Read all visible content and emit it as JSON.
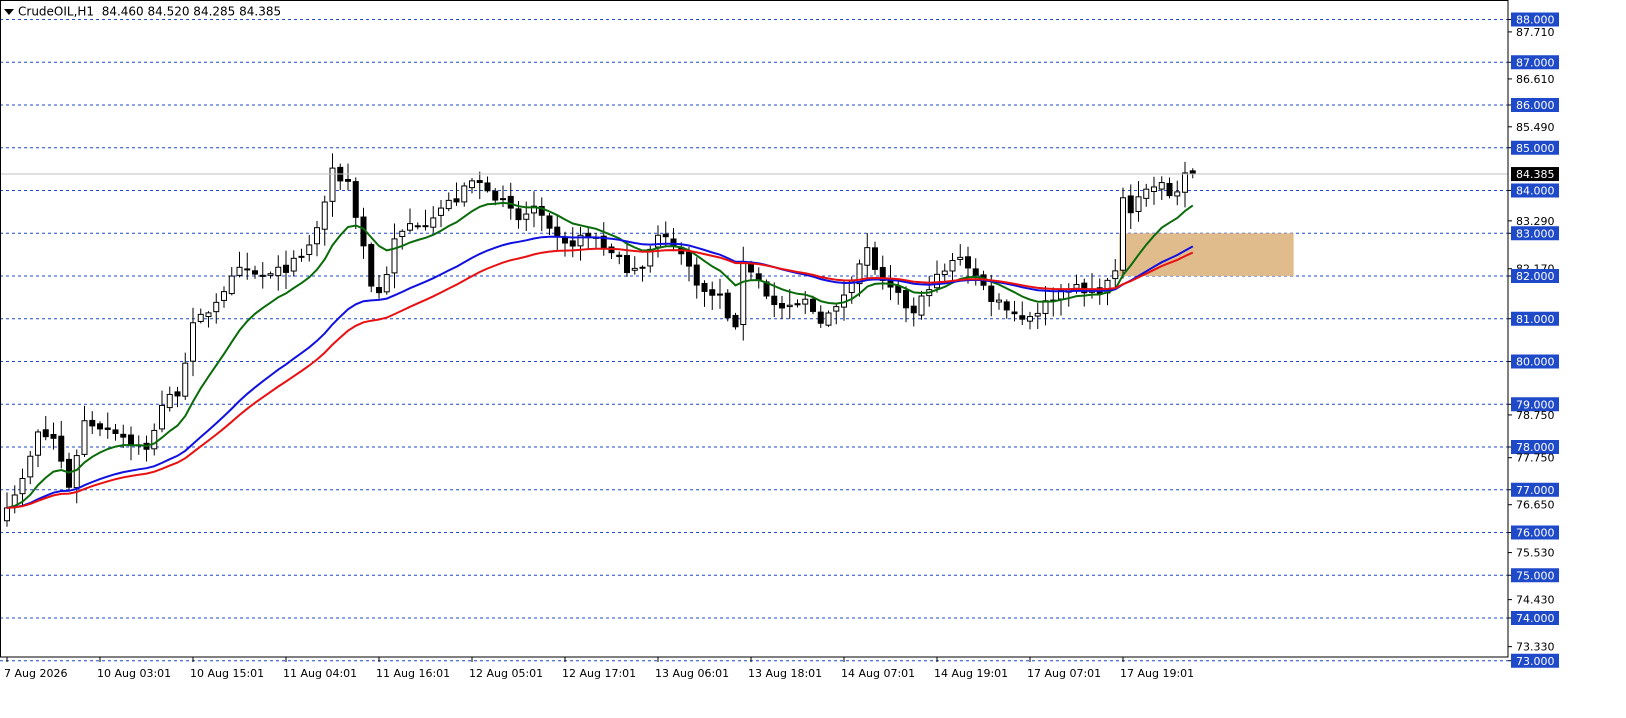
{
  "header": {
    "symbol_timeframe": "CrudeOIL,H1",
    "ohlc": "84.460 84.520 84.285 84.385"
  },
  "colors": {
    "background": "#ffffff",
    "grid": "#1e49c8",
    "candle_bull_body": "#ffffff",
    "candle_bear_body": "#000000",
    "candle_outline": "#000000",
    "ma_fast": "#0a6b0a",
    "ma_mid": "#1010e0",
    "ma_slow": "#e81010",
    "zone_fill": "#deb887",
    "price_line": "#c0c0c0",
    "label_box": "#1e49c8"
  },
  "chart_data": {
    "type": "candlestick",
    "title": "CrudeOIL,H1",
    "ylim": [
      72.9,
      88.3
    ],
    "grid": true,
    "current_price": "84.385",
    "y_grid_levels": [
      88,
      87,
      86,
      85,
      84,
      83,
      82,
      81,
      80,
      79,
      78,
      77,
      76,
      75,
      74,
      73
    ],
    "y_tick_labels": [
      {
        "value": 88.0,
        "label": "88.000",
        "boxed": true
      },
      {
        "value": 87.71,
        "label": "87.710",
        "boxed": false
      },
      {
        "value": 87.0,
        "label": "87.000",
        "boxed": true
      },
      {
        "value": 86.61,
        "label": "86.610",
        "boxed": false
      },
      {
        "value": 86.0,
        "label": "86.000",
        "boxed": true
      },
      {
        "value": 85.49,
        "label": "85.490",
        "boxed": false
      },
      {
        "value": 85.0,
        "label": "85.000",
        "boxed": true
      },
      {
        "value": 84.0,
        "label": "84.000",
        "boxed": true
      },
      {
        "value": 83.29,
        "label": "83.290",
        "boxed": false
      },
      {
        "value": 83.0,
        "label": "83.000",
        "boxed": true
      },
      {
        "value": 82.17,
        "label": "82.170",
        "boxed": false
      },
      {
        "value": 82.0,
        "label": "82.000",
        "boxed": true
      },
      {
        "value": 81.0,
        "label": "81.000",
        "boxed": true
      },
      {
        "value": 80.0,
        "label": "80.000",
        "boxed": true
      },
      {
        "value": 79.0,
        "label": "79.000",
        "boxed": true
      },
      {
        "value": 78.75,
        "label": "78.750",
        "boxed": false
      },
      {
        "value": 78.0,
        "label": "78.000",
        "boxed": true
      },
      {
        "value": 77.75,
        "label": "77.750",
        "boxed": false
      },
      {
        "value": 77.0,
        "label": "77.000",
        "boxed": true
      },
      {
        "value": 76.65,
        "label": "76.650",
        "boxed": false
      },
      {
        "value": 76.0,
        "label": "76.000",
        "boxed": true
      },
      {
        "value": 75.53,
        "label": "75.530",
        "boxed": false
      },
      {
        "value": 75.0,
        "label": "75.000",
        "boxed": true
      },
      {
        "value": 74.43,
        "label": "74.430",
        "boxed": false
      },
      {
        "value": 74.0,
        "label": "74.000",
        "boxed": true
      },
      {
        "value": 73.33,
        "label": "73.330",
        "boxed": false
      },
      {
        "value": 73.0,
        "label": "73.000",
        "boxed": true
      }
    ],
    "x_tick_labels": [
      {
        "bar": 0,
        "label": "7 Aug 2026"
      },
      {
        "bar": 12,
        "label": "10 Aug 03:01"
      },
      {
        "bar": 24,
        "label": "10 Aug 15:01"
      },
      {
        "bar": 36,
        "label": "11 Aug 04:01"
      },
      {
        "bar": 48,
        "label": "11 Aug 16:01"
      },
      {
        "bar": 60,
        "label": "12 Aug 05:01"
      },
      {
        "bar": 72,
        "label": "12 Aug 17:01"
      },
      {
        "bar": 84,
        "label": "13 Aug 06:01"
      },
      {
        "bar": 96,
        "label": "13 Aug 18:01"
      },
      {
        "bar": 108,
        "label": "14 Aug 07:01"
      },
      {
        "bar": 120,
        "label": "14 Aug 19:01"
      },
      {
        "bar": 132,
        "label": "17 Aug 07:01"
      },
      {
        "bar": 144,
        "label": "17 Aug 19:01"
      }
    ],
    "close_anchors": [
      [
        0,
        76.7
      ],
      [
        2,
        77.2
      ],
      [
        4,
        78.3
      ],
      [
        6,
        78.2
      ],
      [
        8,
        77.1
      ],
      [
        10,
        78.6
      ],
      [
        12,
        78.5
      ],
      [
        14,
        78.4
      ],
      [
        16,
        78.1
      ],
      [
        18,
        77.9
      ],
      [
        20,
        79.0
      ],
      [
        22,
        79.3
      ],
      [
        24,
        80.8
      ],
      [
        26,
        81.2
      ],
      [
        28,
        81.7
      ],
      [
        30,
        82.1
      ],
      [
        32,
        82.0
      ],
      [
        34,
        82.0
      ],
      [
        36,
        82.2
      ],
      [
        38,
        82.4
      ],
      [
        40,
        83.1
      ],
      [
        42,
        84.4
      ],
      [
        44,
        84.2
      ],
      [
        46,
        82.7
      ],
      [
        47,
        81.8
      ],
      [
        48,
        81.6
      ],
      [
        49,
        82.1
      ],
      [
        50,
        82.8
      ],
      [
        52,
        83.2
      ],
      [
        54,
        83.3
      ],
      [
        56,
        83.6
      ],
      [
        58,
        83.8
      ],
      [
        60,
        84.2
      ],
      [
        62,
        84.1
      ],
      [
        64,
        83.7
      ],
      [
        66,
        83.3
      ],
      [
        68,
        83.6
      ],
      [
        70,
        83.0
      ],
      [
        72,
        82.7
      ],
      [
        74,
        82.9
      ],
      [
        76,
        82.9
      ],
      [
        78,
        82.5
      ],
      [
        80,
        82.2
      ],
      [
        82,
        82.3
      ],
      [
        84,
        82.9
      ],
      [
        86,
        82.8
      ],
      [
        88,
        82.2
      ],
      [
        90,
        81.6
      ],
      [
        92,
        81.5
      ],
      [
        94,
        80.7
      ],
      [
        95,
        82.4
      ],
      [
        97,
        81.9
      ],
      [
        99,
        81.3
      ],
      [
        101,
        81.2
      ],
      [
        103,
        81.4
      ],
      [
        105,
        81.0
      ],
      [
        107,
        81.2
      ],
      [
        109,
        82.0
      ],
      [
        111,
        82.6
      ],
      [
        113,
        81.8
      ],
      [
        115,
        81.5
      ],
      [
        117,
        81.1
      ],
      [
        119,
        81.8
      ],
      [
        121,
        82.1
      ],
      [
        123,
        82.5
      ],
      [
        125,
        82.0
      ],
      [
        127,
        81.5
      ],
      [
        129,
        81.3
      ],
      [
        131,
        81.0
      ],
      [
        133,
        81.2
      ],
      [
        135,
        81.5
      ],
      [
        137,
        81.8
      ],
      [
        139,
        81.6
      ],
      [
        141,
        81.7
      ],
      [
        143,
        82.0
      ],
      [
        144,
        83.9
      ],
      [
        145,
        83.6
      ],
      [
        146,
        83.9
      ],
      [
        148,
        84.1
      ],
      [
        149,
        84.1
      ],
      [
        150,
        83.9
      ],
      [
        151,
        84.0
      ],
      [
        152,
        84.4
      ],
      [
        153,
        84.385
      ]
    ],
    "zone": {
      "price_top": 83.0,
      "price_bottom": 82.0,
      "bar_from": 143,
      "bar_to": 165.5
    },
    "moving_averages": [
      {
        "role": "fast",
        "color_key": "ma_fast",
        "period": 12
      },
      {
        "role": "mid",
        "color_key": "ma_mid",
        "period": 36
      },
      {
        "role": "slow",
        "color_key": "ma_slow",
        "period": 45
      }
    ]
  }
}
